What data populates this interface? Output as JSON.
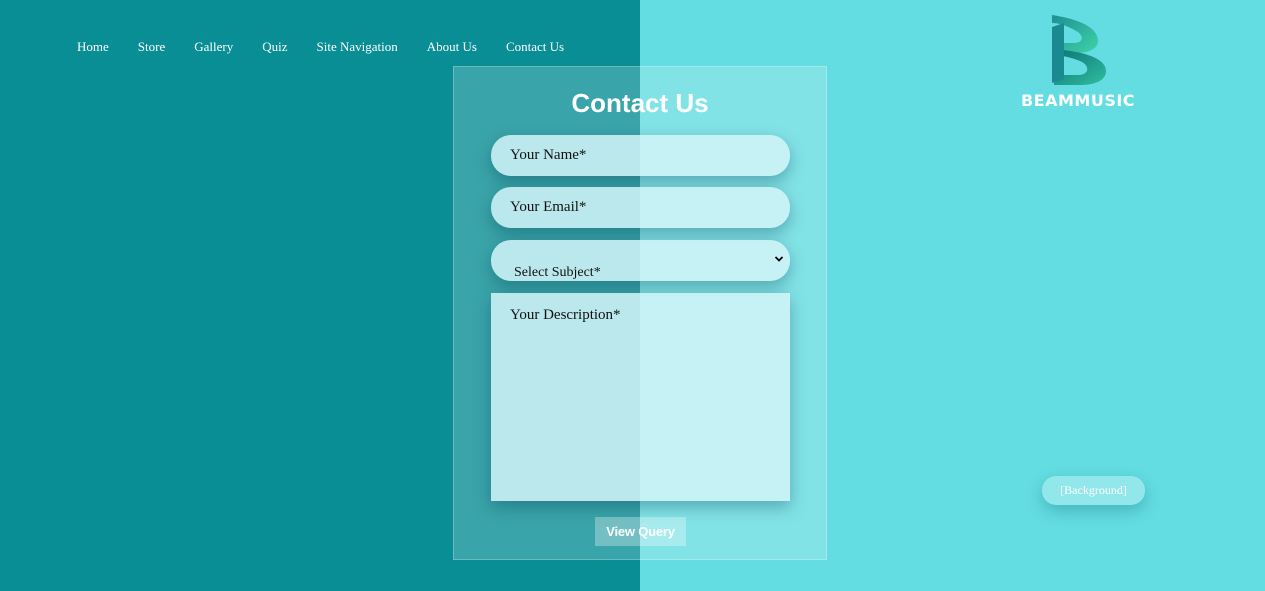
{
  "nav": {
    "items": [
      {
        "label": "Home"
      },
      {
        "label": "Store"
      },
      {
        "label": "Gallery"
      },
      {
        "label": "Quiz"
      },
      {
        "label": "Site Navigation"
      },
      {
        "label": "About Us"
      },
      {
        "label": "Contact Us"
      }
    ]
  },
  "brand": {
    "name": "BEAMMUSIC",
    "icon": "beam-logo-icon"
  },
  "form": {
    "title": "Contact Us",
    "name_placeholder": "Your Name*",
    "email_placeholder": "Your Email*",
    "subject_selected": "Select Subject*",
    "description_placeholder": "Your Description*",
    "submit_label": "View Query"
  },
  "background_toggle": {
    "label": "[Background]"
  },
  "colors": {
    "left_background": "#088e94",
    "right_background": "#63dde2",
    "text": "#ffffff"
  }
}
